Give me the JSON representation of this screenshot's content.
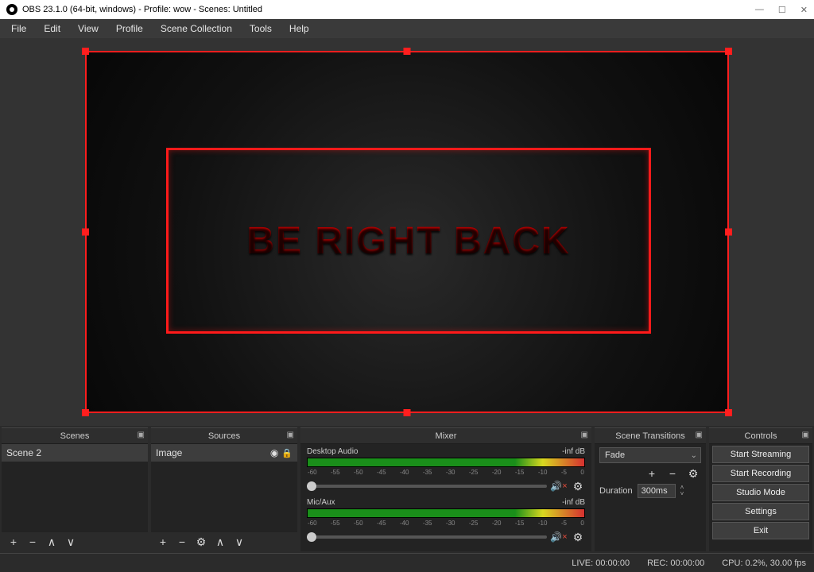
{
  "window": {
    "title": "OBS 23.1.0 (64-bit, windows) - Profile: wow - Scenes: Untitled"
  },
  "menu": [
    "File",
    "Edit",
    "View",
    "Profile",
    "Scene Collection",
    "Tools",
    "Help"
  ],
  "preview": {
    "text": "BE RIGHT BACK"
  },
  "scenes": {
    "title": "Scenes",
    "items": [
      "Scene 2"
    ]
  },
  "sources": {
    "title": "Sources",
    "items": [
      "Image"
    ]
  },
  "mixer": {
    "title": "Mixer",
    "channels": [
      {
        "name": "Desktop Audio",
        "level": "-inf dB"
      },
      {
        "name": "Mic/Aux",
        "level": "-inf dB"
      }
    ],
    "ticks": [
      "-60",
      "-55",
      "-50",
      "-45",
      "-40",
      "-35",
      "-30",
      "-25",
      "-20",
      "-15",
      "-10",
      "-5",
      "0"
    ]
  },
  "transitions": {
    "title": "Scene Transitions",
    "current": "Fade",
    "duration_label": "Duration",
    "duration": "300ms"
  },
  "controls": {
    "title": "Controls",
    "buttons": [
      "Start Streaming",
      "Start Recording",
      "Studio Mode",
      "Settings",
      "Exit"
    ]
  },
  "status": {
    "live": "LIVE: 00:00:00",
    "rec": "REC: 00:00:00",
    "cpu": "CPU: 0.2%, 30.00 fps"
  },
  "glyphs": {
    "minimize": "—",
    "maximize": "☐",
    "close": "✕",
    "dock": "▣",
    "plus": "+",
    "minus": "−",
    "up": "∧",
    "down": "∨",
    "gear": "⚙",
    "speaker": "🔊",
    "eye": "👁",
    "lock": "🔒",
    "chev": "⌄",
    "chev_up": "˄",
    "chev_down": "˅",
    "mute": "×"
  }
}
